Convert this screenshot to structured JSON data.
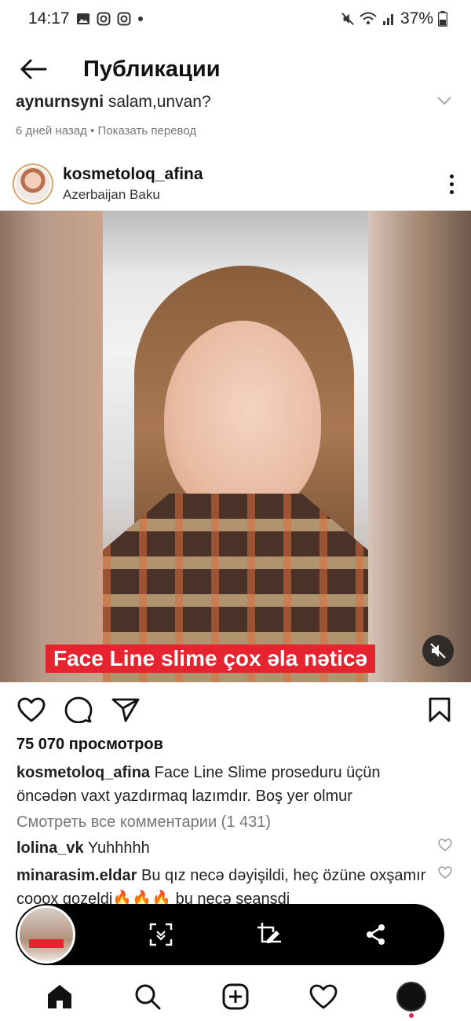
{
  "status_bar": {
    "time": "14:17",
    "battery": "37%"
  },
  "header": {
    "title": "Публикации"
  },
  "prev_comment": {
    "username": "aynurnsyni",
    "text": "salam,unvan?",
    "time": "6 дней назад",
    "translate": "Показать перевод"
  },
  "post": {
    "username": "kosmetoloq_afina",
    "location": "Azerbaijan Baku",
    "video_caption": "Face Line slime çox əla nəticə",
    "views": "75 070 просмотров",
    "caption_user": "kosmetoloq_afina",
    "caption_text": "Face Line Slime proseduru üçün öncədən vaxt yazdırmaq lazımdır. Boş yer olmur",
    "view_all_comments": "Смотреть все комментарии (1 431)"
  },
  "comments": [
    {
      "user": "lolina_vk",
      "text": "Yuhhhhh"
    },
    {
      "user": "minarasim.eldar",
      "text": "Bu qız necə dəyişildi, heç özüne oxşamır coooх gozeldi🔥🔥🔥 bu neçə seansdi"
    }
  ],
  "pip": {
    "thumbnail_text": "Face Line slime çox əla nəticə"
  },
  "colors": {
    "accent_red": "#e5242f",
    "text_primary": "#111111",
    "text_secondary": "#777777"
  },
  "icons": [
    "back-arrow-icon",
    "chevron-down-icon",
    "more-vertical-icon",
    "mute-icon",
    "heart-icon",
    "comment-icon",
    "share-icon",
    "bookmark-icon",
    "expand-icon",
    "edit-crop-icon",
    "share-node-icon",
    "home-icon",
    "search-icon",
    "add-post-icon",
    "activity-heart-icon",
    "profile-avatar-icon"
  ]
}
